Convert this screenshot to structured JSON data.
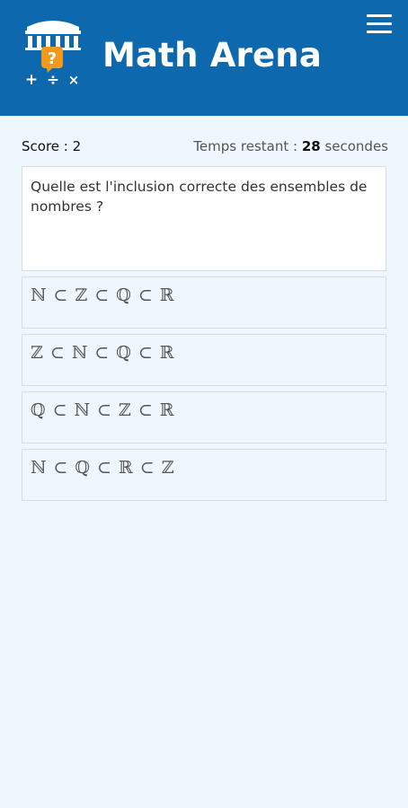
{
  "header": {
    "title": "Math Arena",
    "logo_symbols": [
      "?",
      "+",
      "÷",
      "×"
    ],
    "menu_icon": "hamburger-menu-icon",
    "background_color": "#0d68ae"
  },
  "status": {
    "score_label": "Score : 2",
    "timer_prefix": "Temps restant : ",
    "timer_value": "28",
    "timer_suffix": " secondes"
  },
  "question": {
    "text": "Quelle est l'inclusion correcte des ensembles de nombres ?"
  },
  "answers": [
    {
      "label": "ℕ ⊂ ℤ ⊂ ℚ ⊂ ℝ"
    },
    {
      "label": "ℤ ⊂ ℕ ⊂ ℚ ⊂ ℝ"
    },
    {
      "label": "ℚ ⊂ ℕ ⊂ ℤ ⊂ ℝ"
    },
    {
      "label": "ℕ ⊂ ℚ ⊂ ℝ ⊂ ℤ"
    }
  ]
}
